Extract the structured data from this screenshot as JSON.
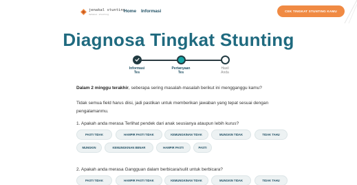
{
  "nav": {
    "logo_text": "jenakal stunting",
    "logo_subtext": "deteksi stunting",
    "home_label": "Home",
    "info_label": "Informasi",
    "cta_label": "CEK TINGKAT STUNTING KAMU"
  },
  "page": {
    "title": "Diagnosa Tingkat Stunting"
  },
  "stepper": {
    "steps": [
      {
        "label_line1": "Informasi",
        "label_line2": "Tes",
        "status": "done"
      },
      {
        "label_line1": "Pertanyaan",
        "label_line2": "Tes",
        "status": "active"
      },
      {
        "label_line1": "Hasil",
        "label_line2": "Anda",
        "status": "pending"
      }
    ]
  },
  "intro": {
    "bold_part": "Dalam 2 minggu terakhir",
    "rest": ", seberapa sering masalah-masalah berikut ini mengganggu kamu?"
  },
  "notice": "Tidak semua field harus diisi, jadi pastikan untuk memberikan jawaban yang tepat sesuai dengan pengalamanmu.",
  "questions": [
    {
      "text": "1. Apakah anda merasa Terlihat pendek dari anak seusianya ataupun lebih kurus?",
      "options": [
        "PASTI TIDAK",
        "HAMPIR PASTI TIDAK",
        "KEMUNGKINAN TIDAK",
        "MUNGKIN TIDAK",
        "TIDAK TAHU",
        "MUNGKIN",
        "KEMUNGKINAN BENAR",
        "HAMPIR PASTI",
        "PASTI"
      ]
    },
    {
      "text": "2. Apakah anda merasa Gangguan dalam berbicara/sulit untuk berbicara?",
      "options": [
        "PASTI TIDAK",
        "HAMPIR PASTI TIDAK",
        "KEMUNGKINAN TIDAK",
        "MUNGKIN TIDAK",
        "TIDAK TAHU"
      ]
    }
  ],
  "colors": {
    "primary": "#1f6a7f",
    "accent": "#f08a43",
    "active_step": "#16a6a6",
    "option_bg": "#edf2f3"
  }
}
